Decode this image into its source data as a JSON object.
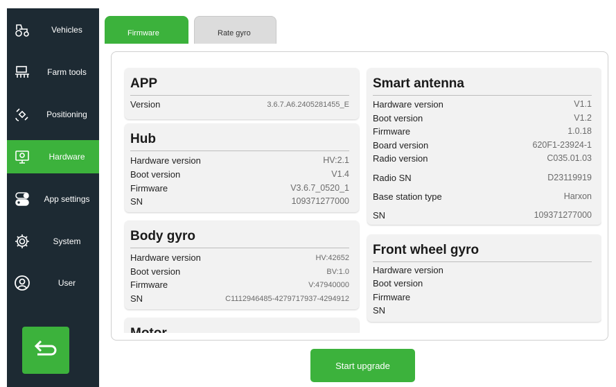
{
  "sidebar": {
    "items": [
      {
        "label": "Vehicles",
        "icon": "tractor-icon"
      },
      {
        "label": "Farm tools",
        "icon": "farm-tool-icon"
      },
      {
        "label": "Positioning",
        "icon": "satellite-icon"
      },
      {
        "label": "Hardware",
        "icon": "monitor-icon",
        "active": true
      },
      {
        "label": "App settings",
        "icon": "toggle-icon"
      },
      {
        "label": "System",
        "icon": "gear-icon"
      },
      {
        "label": "User",
        "icon": "user-icon"
      }
    ],
    "back_icon": "back-arrow-icon"
  },
  "tabs": [
    {
      "label": "Firmware",
      "active": true
    },
    {
      "label": "Rate gyro",
      "active": false
    }
  ],
  "cards": {
    "app": {
      "title": "APP",
      "rows": [
        {
          "key": "Version",
          "value": "3.6.7.A6.2405281455_E"
        }
      ]
    },
    "hub": {
      "title": "Hub",
      "rows": [
        {
          "key": "Hardware version",
          "value": "HV:2.1"
        },
        {
          "key": "Boot version",
          "value": "V1.4"
        },
        {
          "key": "Firmware",
          "value": "V3.6.7_0520_1"
        },
        {
          "key": "SN",
          "value": "109371277000"
        }
      ]
    },
    "body_gyro": {
      "title": "Body gyro",
      "rows": [
        {
          "key": "Hardware version",
          "value": "HV:42652"
        },
        {
          "key": "Boot version",
          "value": "BV:1.0"
        },
        {
          "key": "Firmware",
          "value": "V:47940000"
        },
        {
          "key": "SN",
          "value": "C1112946485-4279717937-4294912"
        }
      ]
    },
    "motor": {
      "title": "Motor"
    },
    "smart_antenna": {
      "title": "Smart antenna",
      "rows": [
        {
          "key": "Hardware version",
          "value": "V1.1"
        },
        {
          "key": "Boot version",
          "value": "V1.2"
        },
        {
          "key": "Firmware",
          "value": "1.0.18"
        },
        {
          "key": "Board version",
          "value": "620F1-23924-1"
        },
        {
          "key": "Radio version",
          "value": "C035.01.03"
        },
        {
          "key": "Radio SN",
          "value": "D23119919"
        },
        {
          "key": "Base station type",
          "value": "Harxon"
        },
        {
          "key": "SN",
          "value": "109371277000"
        }
      ]
    },
    "front_wheel_gyro": {
      "title": "Front wheel gyro",
      "rows": [
        {
          "key": "Hardware version",
          "value": ""
        },
        {
          "key": "Boot version",
          "value": ""
        },
        {
          "key": "Firmware",
          "value": ""
        },
        {
          "key": "SN",
          "value": ""
        }
      ]
    }
  },
  "actions": {
    "upgrade_label": "Start upgrade"
  },
  "colors": {
    "accent": "#3cb23c",
    "sidebar_bg": "#1d2a33"
  }
}
